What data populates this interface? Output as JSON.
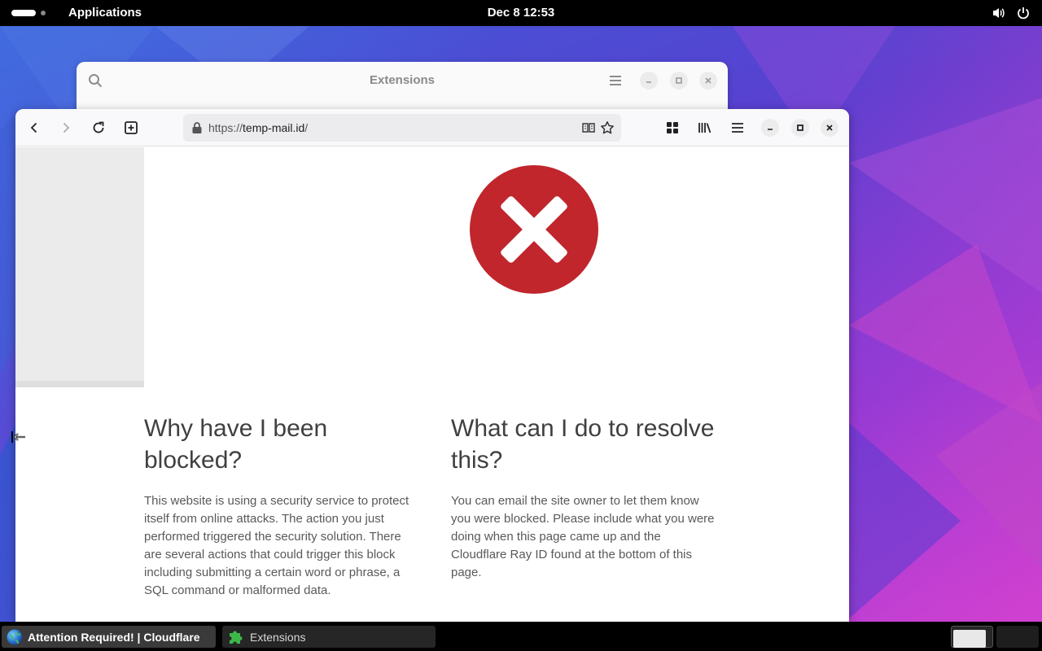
{
  "topbar": {
    "applications_label": "Applications",
    "clock": "Dec 8  12:53",
    "icons": [
      "volume-icon",
      "power-icon"
    ]
  },
  "extensions_window": {
    "title": "Extensions",
    "icons": [
      "search-icon",
      "hamburger-menu-icon",
      "minimize-icon",
      "maximize-icon",
      "close-icon"
    ]
  },
  "browser": {
    "url_scheme": "https://",
    "url_host": "temp-mail.id",
    "url_path": "/",
    "toolbar_icons": [
      "back-icon",
      "forward-icon",
      "reload-icon",
      "new-tab-icon",
      "lock-icon",
      "reader-view-icon",
      "bookmark-star-icon",
      "extensions-grid-icon",
      "library-icon",
      "menu-icon",
      "minimize-icon",
      "maximize-icon",
      "close-icon"
    ]
  },
  "page": {
    "error_icon": "error-x-icon",
    "error_color": "#c0262c",
    "why_heading": "Why have I been blocked?",
    "why_body": "This website is using a security service to protect itself from online attacks. The action you just performed triggered the security solution. There are several actions that could trigger this block including submitting a certain word or phrase, a SQL command or malformed data.",
    "resolve_heading": "What can I do to resolve this?",
    "resolve_body": "You can email the site owner to let them know you were blocked. Please include what you were doing when this page came up and the Cloudflare Ray ID found at the bottom of this page."
  },
  "taskbar": {
    "tasks": [
      {
        "label": "Attention Required! | Cloudflare",
        "icon": "globe-icon",
        "active": true
      },
      {
        "label": "Extensions",
        "icon": "puzzle-icon",
        "active": false
      }
    ]
  }
}
